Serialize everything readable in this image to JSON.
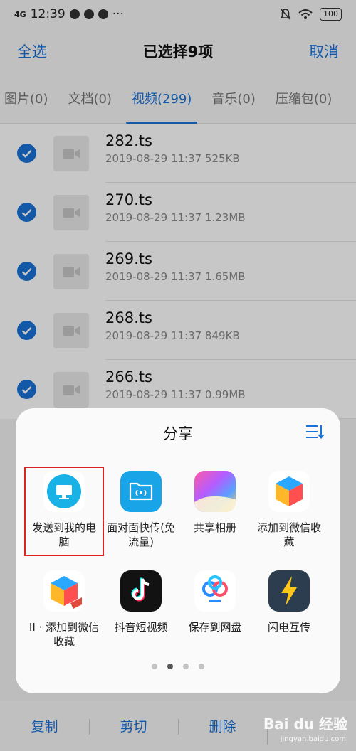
{
  "status": {
    "signal": "4G",
    "time": "12:39",
    "more": "···",
    "battery": "100"
  },
  "header": {
    "select_all": "全选",
    "title": "已选择9项",
    "cancel": "取消"
  },
  "tabs": [
    {
      "label": "图片(0)"
    },
    {
      "label": "文档(0)"
    },
    {
      "label": "视频(299)"
    },
    {
      "label": "音乐(0)"
    },
    {
      "label": "压缩包(0)"
    }
  ],
  "files": [
    {
      "name": "282.ts",
      "meta": "2019-08-29 11:37   525KB"
    },
    {
      "name": "270.ts",
      "meta": "2019-08-29 11:37   1.23MB"
    },
    {
      "name": "269.ts",
      "meta": "2019-08-29 11:37   1.65MB"
    },
    {
      "name": "268.ts",
      "meta": "2019-08-29 11:37   849KB"
    },
    {
      "name": "266.ts",
      "meta": "2019-08-29 11:37   0.99MB"
    }
  ],
  "share_sheet": {
    "title": "分享",
    "apps": [
      {
        "label": "发送到我的电脑",
        "icon": "computer-icon"
      },
      {
        "label": "面对面快传(免流量)",
        "icon": "folder-wireless-icon"
      },
      {
        "label": "共享相册",
        "icon": "shared-album-icon"
      },
      {
        "label": "添加到微信收藏",
        "icon": "cube-icon"
      },
      {
        "label": "II · 添加到微信收藏",
        "icon": "cube-icon"
      },
      {
        "label": "抖音短视频",
        "icon": "tiktok-icon"
      },
      {
        "label": "保存到网盘",
        "icon": "cloud-drive-icon"
      },
      {
        "label": "闪电互传",
        "icon": "lightning-icon"
      }
    ]
  },
  "bottom_bar": {
    "copy": "复制",
    "cut": "剪切",
    "delete": "删除"
  },
  "watermark": {
    "brand": "Bai du 经验",
    "url": "jingyan.baidu.com"
  },
  "colors": {
    "accent": "#1a73d8",
    "highlight": "#dd2222"
  }
}
